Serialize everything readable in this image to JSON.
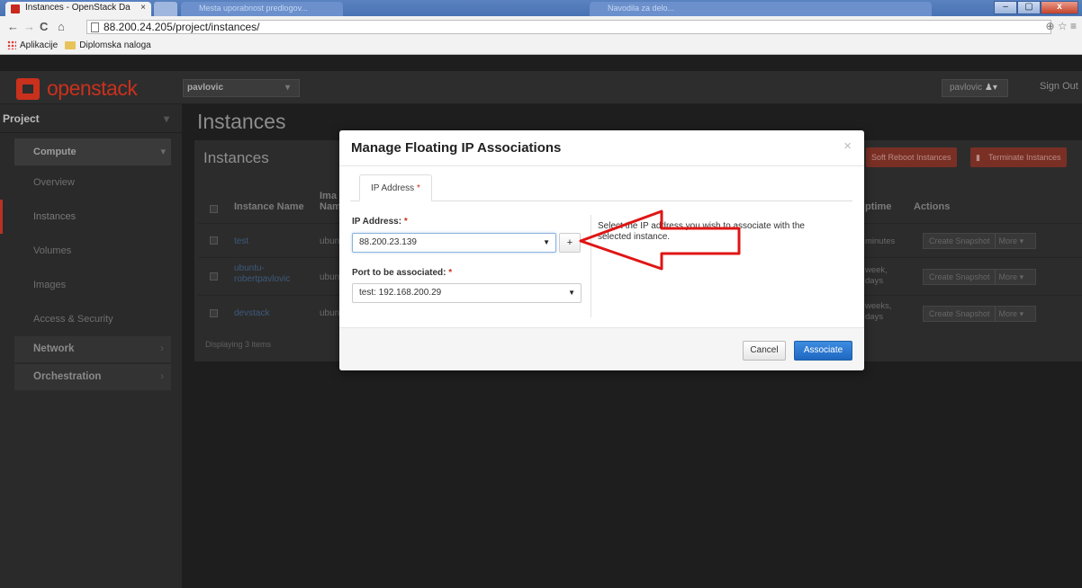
{
  "browser": {
    "tab_title": "Instances - OpenStack Da",
    "tab_close": "×",
    "blurred_tab_1": "Mesta uporabnost predlogov...",
    "blurred_tab_2": "Navodila za delo...",
    "url": "88.200.24.205/project/instances/",
    "bookmarks": [
      "Aplikacije",
      "Diplomska naloga"
    ],
    "window_buttons": [
      "–",
      "▢",
      "x"
    ]
  },
  "topbar": {
    "logo_text": "openstack",
    "project": "pavlovic",
    "user": "pavlovic",
    "signout": "Sign Out"
  },
  "sidebar": {
    "project_label": "Project",
    "compute_label": "Compute",
    "items": [
      {
        "label": "Overview"
      },
      {
        "label": "Instances"
      },
      {
        "label": "Volumes"
      },
      {
        "label": "Images"
      },
      {
        "label": "Access & Security"
      }
    ],
    "network_label": "Network",
    "orchestration_label": "Orchestration"
  },
  "main": {
    "heading": "Instances",
    "panel_title": "Instances",
    "soft_reboot": "Soft Reboot Instances",
    "terminate": "Terminate Instances",
    "columns": {
      "name": "Instance Name",
      "image_1": "Ima",
      "image_2": "Nam",
      "uptime": "ptime",
      "actions": "Actions"
    },
    "rows": [
      {
        "name": "test",
        "name2": "",
        "image": "ubun",
        "uptime1": "minutes",
        "uptime2": ""
      },
      {
        "name": "ubuntu-",
        "name2": "robertpavlovic",
        "image": "ubun",
        "uptime1": "week,",
        "uptime2": "days"
      },
      {
        "name": "devstack",
        "name2": "",
        "image": "ubun",
        "uptime1": "weeks,",
        "uptime2": "days"
      }
    ],
    "action_primary": "Create Snapshot",
    "action_more": "More",
    "displaying": "Displaying 3 items"
  },
  "modal": {
    "title": "Manage Floating IP Associations",
    "close": "×",
    "tab_label": "IP Address",
    "required_marker": "*",
    "ip_label": "IP Address:",
    "ip_value": "88.200.23.139",
    "plus": "+",
    "port_label": "Port to be associated:",
    "port_value": "test: 192.168.200.29",
    "help_text": "Select the IP address you wish to associate with the selected instance.",
    "cancel": "Cancel",
    "associate": "Associate"
  },
  "colors": {
    "brand_red": "#c9311d",
    "primary_blue": "#1f67c2",
    "annotation_arrow": "#e01515"
  }
}
